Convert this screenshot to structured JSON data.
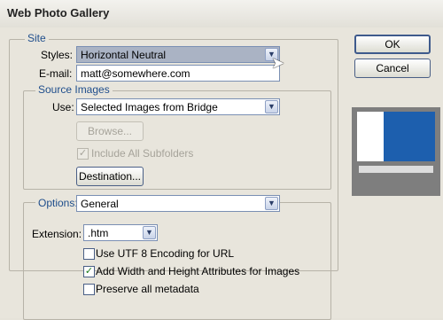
{
  "window": {
    "title": "Web Photo Gallery"
  },
  "site": {
    "legend": "Site",
    "styles_label": "Styles:",
    "styles_value": "Horizontal Neutral",
    "email_label": "E-mail:",
    "email_value": "matt@somewhere.com"
  },
  "source": {
    "legend": "Source Images",
    "use_label": "Use:",
    "use_value": "Selected Images from Bridge",
    "browse_label": "Browse...",
    "include_subfolders_label": "Include All Subfolders",
    "destination_label": "Destination..."
  },
  "options": {
    "legend": "Options:",
    "value": "General",
    "extension_label": "Extension:",
    "extension_value": ".htm",
    "utf8_label": "Use UTF 8 Encoding for URL",
    "width_height_label": "Add Width and Height Attributes for Images",
    "preserve_label": "Preserve all metadata",
    "checks": {
      "utf8": false,
      "width_height": true,
      "preserve": false
    }
  },
  "buttons": {
    "ok": "OK",
    "cancel": "Cancel"
  }
}
